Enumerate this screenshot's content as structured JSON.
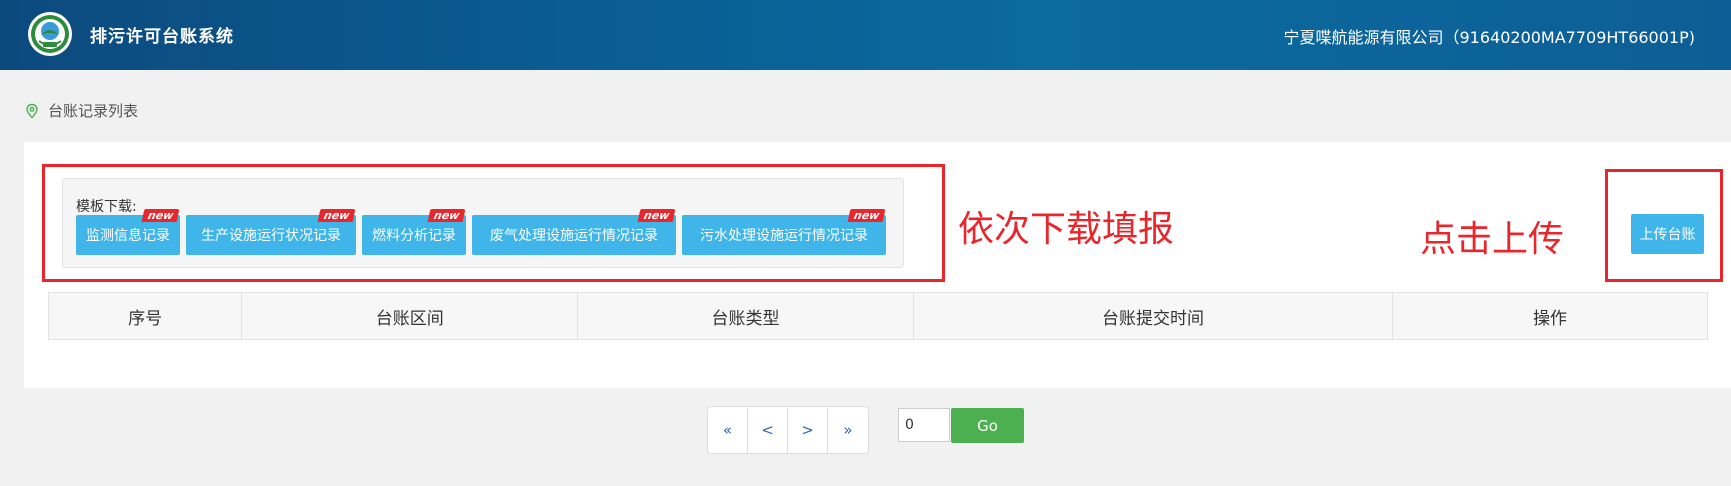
{
  "header": {
    "app_title": "排污许可台账系统",
    "company": "宁夏喋航能源有限公司（91640200MA7709HT66001P)"
  },
  "breadcrumb": {
    "icon": "location-pin-icon",
    "label": "台账记录列表"
  },
  "templates": {
    "label": "模板下载:",
    "badge": "new",
    "buttons": [
      "监测信息记录",
      "生产设施运行状况记录",
      "燃料分析记录",
      "废气处理设施运行情况记录",
      "污水处理设施运行情况记录"
    ]
  },
  "annotations": {
    "download_hint": "依次下载填报",
    "upload_hint": "点击上传",
    "color": "#e8262b"
  },
  "upload_button": "上传台账",
  "table": {
    "columns": [
      "序号",
      "台账区间",
      "台账类型",
      "台账提交时间",
      "操作"
    ]
  },
  "pagination": {
    "first": "«",
    "prev": "<",
    "next": ">",
    "last": "»",
    "page_input_value": "0",
    "go_label": "Go"
  },
  "colors": {
    "header_bg": "#0b5f96",
    "button_bg": "#3fb5e9",
    "go_bg": "#4caf50",
    "badge_bg": "#e8262b"
  }
}
